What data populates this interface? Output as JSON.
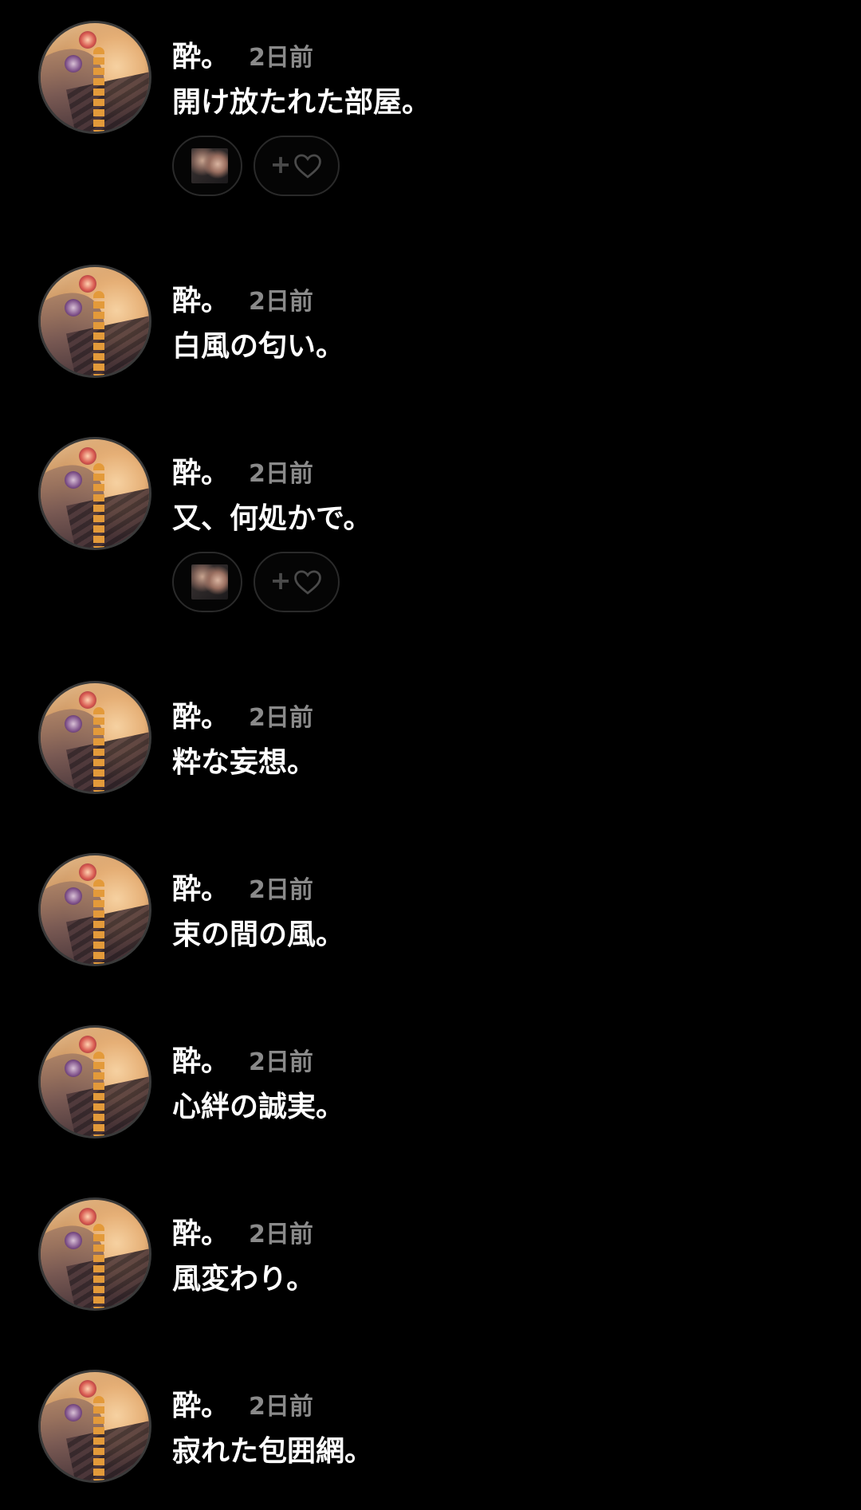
{
  "posts": [
    {
      "username": "酔。",
      "time": "2日前",
      "text": "開け放たれた部屋。",
      "has_reactions": true,
      "add_reaction_plus": "+"
    },
    {
      "username": "酔。",
      "time": "2日前",
      "text": "白風の匂い。",
      "has_reactions": false
    },
    {
      "username": "酔。",
      "time": "2日前",
      "text": "又、何処かで。",
      "has_reactions": true,
      "add_reaction_plus": "+"
    },
    {
      "username": "酔。",
      "time": "2日前",
      "text": "粋な妄想。",
      "has_reactions": false
    },
    {
      "username": "酔。",
      "time": "2日前",
      "text": "束の間の風。",
      "has_reactions": false
    },
    {
      "username": "酔。",
      "time": "2日前",
      "text": "心絆の誠実。",
      "has_reactions": false
    },
    {
      "username": "酔。",
      "time": "2日前",
      "text": "風変わり。",
      "has_reactions": false
    },
    {
      "username": "酔。",
      "time": "2日前",
      "text": "寂れた包囲網。",
      "has_reactions": false
    }
  ],
  "icons": {
    "add_reaction": "heart-outline-icon"
  },
  "colors": {
    "background": "#000000",
    "username": "#ffffff",
    "time": "#8a8a8a",
    "reaction_border": "#2a2a2a",
    "reaction_icon": "#4a4a4a"
  }
}
